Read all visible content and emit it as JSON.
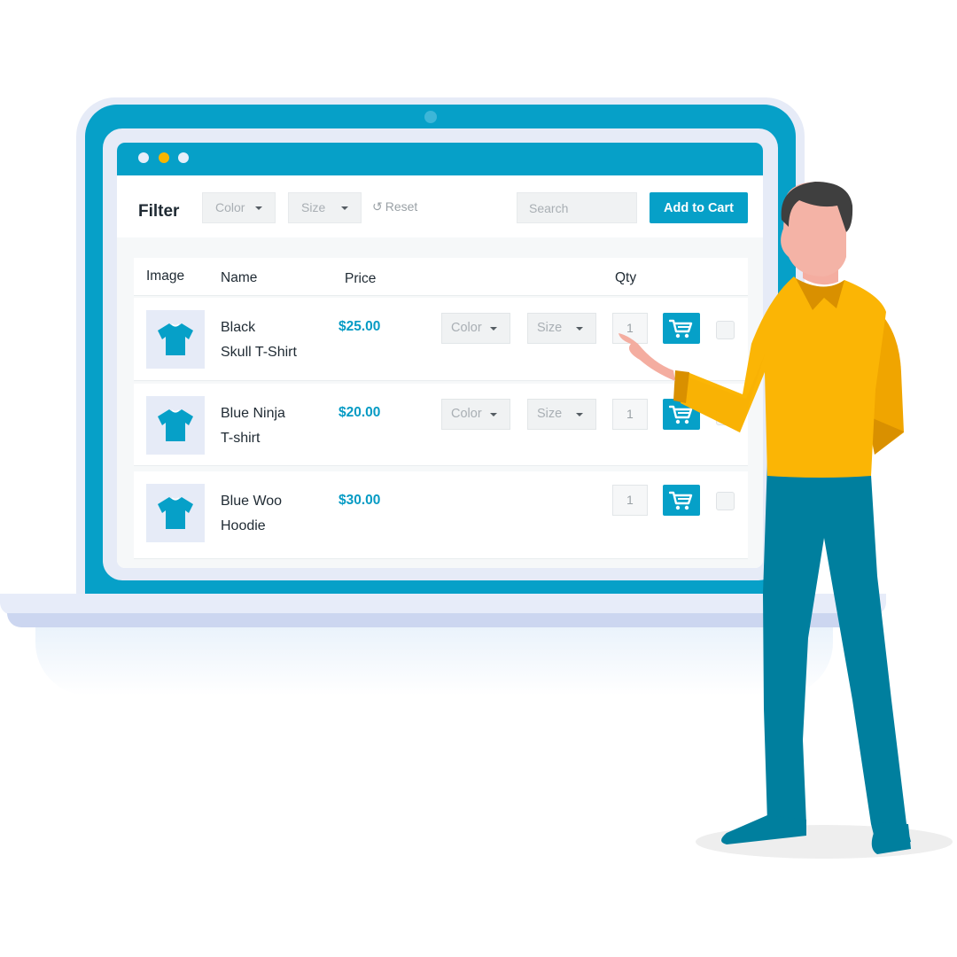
{
  "colors": {
    "accent": "#06a0c8",
    "price": "#069bc4",
    "window_dot_active": "#f7b500",
    "person_shirt": "#fbb505",
    "person_pants": "#007f9e"
  },
  "toolbar": {
    "title": "Filter",
    "color_select": "Color",
    "size_select": "Size",
    "reset_label": "Reset",
    "search_placeholder": "Search",
    "add_to_cart_label": "Add to Cart"
  },
  "table": {
    "headers": {
      "image": "Image",
      "name": "Name",
      "price": "Price",
      "qty": "Qty"
    },
    "rows": [
      {
        "name_line1": "Black",
        "name_line2": "Skull T-Shirt",
        "price": "$25.00",
        "color": "Color",
        "size": "Size",
        "qty": "1",
        "icon": "tshirt-icon"
      },
      {
        "name_line1": "Blue Ninja",
        "name_line2": "T-shirt",
        "price": "$20.00",
        "color": "Color",
        "size": "Size",
        "qty": "1",
        "icon": "tshirt-icon"
      },
      {
        "name_line1": "Blue Woo",
        "name_line2": "Hoodie",
        "price": "$30.00",
        "qty": "1",
        "icon": "tshirt-icon"
      }
    ]
  }
}
